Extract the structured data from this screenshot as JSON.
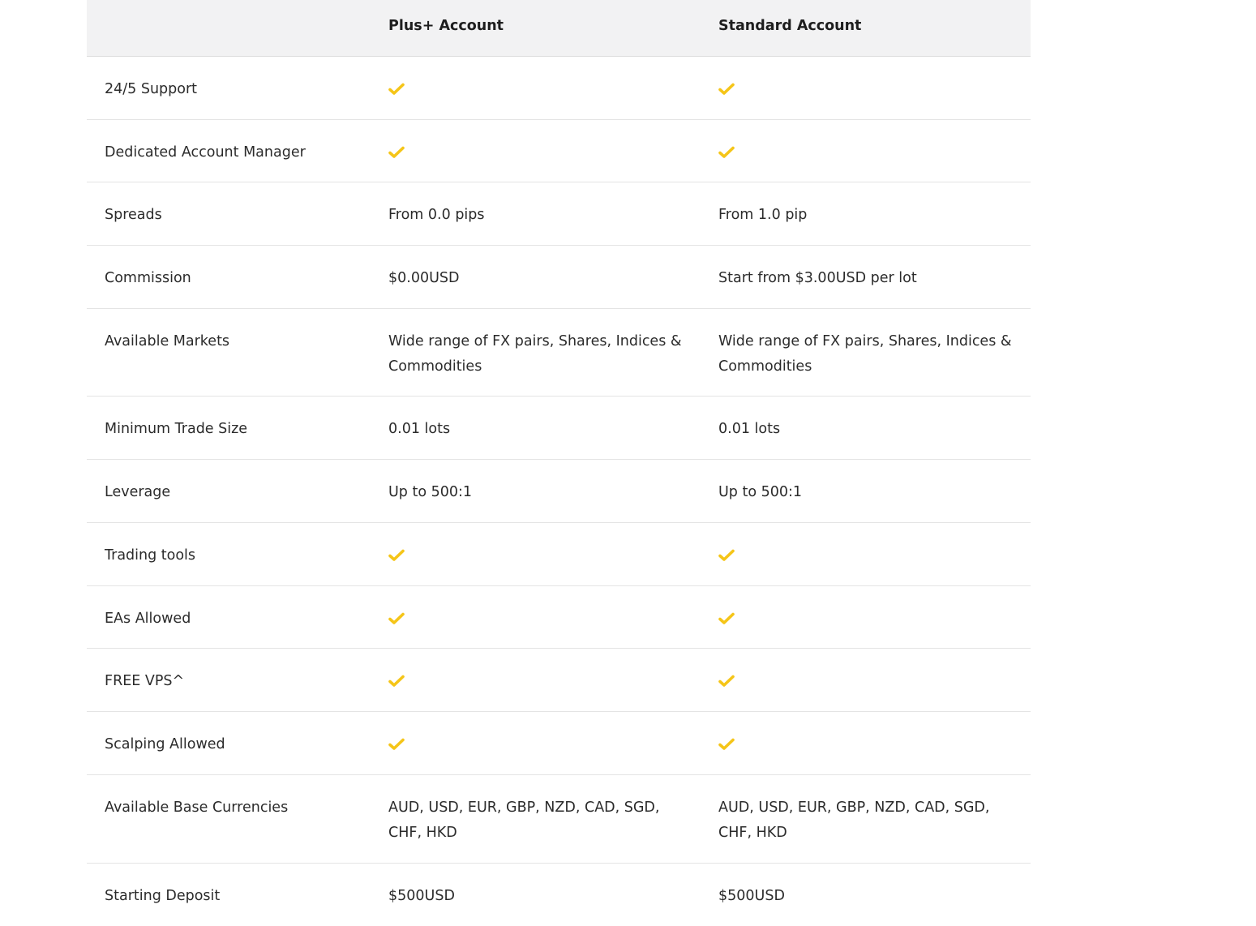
{
  "header": {
    "col_feature": "",
    "col_plus": "Plus+ Account",
    "col_standard": "Standard Account"
  },
  "colors": {
    "check": "#f5c518",
    "header_bg": "#f2f2f3",
    "divider": "#e4e4e4",
    "text": "#2b2b2b"
  },
  "rows": [
    {
      "feature": "24/5 Support",
      "plus": {
        "check": true
      },
      "standard": {
        "check": true
      }
    },
    {
      "feature": "Dedicated Account Manager",
      "plus": {
        "check": true
      },
      "standard": {
        "check": true
      }
    },
    {
      "feature": "Spreads",
      "plus": {
        "lines": [
          "From 0.0 pips"
        ]
      },
      "standard": {
        "lines": [
          "From 1.0 pip"
        ]
      }
    },
    {
      "feature": "Commission",
      "plus": {
        "lines": [
          "$0.00USD"
        ]
      },
      "standard": {
        "lines": [
          "Start from $3.00USD per lot"
        ]
      }
    },
    {
      "feature": "Available Markets",
      "plus": {
        "lines": [
          "Wide range of FX pairs, Shares, Indices &",
          "Commodities"
        ]
      },
      "standard": {
        "lines": [
          "Wide range of FX pairs, Shares, Indices &",
          "Commodities"
        ]
      }
    },
    {
      "feature": "Minimum Trade Size",
      "plus": {
        "lines": [
          "0.01 lots"
        ]
      },
      "standard": {
        "lines": [
          "0.01 lots"
        ]
      }
    },
    {
      "feature": "Leverage",
      "plus": {
        "lines": [
          "Up to 500:1"
        ]
      },
      "standard": {
        "lines": [
          "Up to 500:1"
        ]
      }
    },
    {
      "feature": "Trading tools",
      "plus": {
        "check": true
      },
      "standard": {
        "check": true
      }
    },
    {
      "feature": "EAs Allowed",
      "plus": {
        "check": true
      },
      "standard": {
        "check": true
      }
    },
    {
      "feature": "FREE VPS^",
      "plus": {
        "check": true
      },
      "standard": {
        "check": true
      }
    },
    {
      "feature": "Scalping Allowed",
      "plus": {
        "check": true
      },
      "standard": {
        "check": true
      }
    },
    {
      "feature": "Available Base Currencies",
      "plus": {
        "lines": [
          "AUD, USD, EUR, GBP, NZD, CAD, SGD,",
          "CHF, HKD"
        ]
      },
      "standard": {
        "lines": [
          "AUD, USD, EUR, GBP, NZD, CAD, SGD,",
          "CHF, HKD"
        ]
      }
    },
    {
      "feature": "Starting Deposit",
      "plus": {
        "lines": [
          "$500USD"
        ]
      },
      "standard": {
        "lines": [
          "$500USD"
        ]
      }
    }
  ]
}
